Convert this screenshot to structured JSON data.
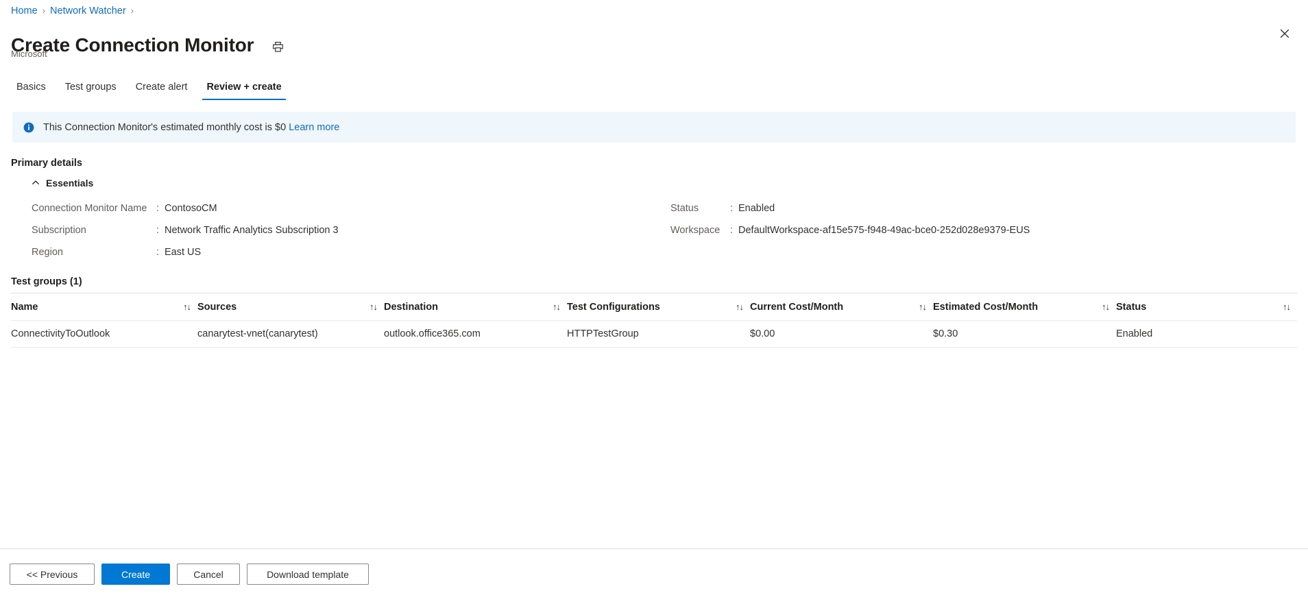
{
  "breadcrumb": {
    "items": [
      {
        "label": "Home"
      },
      {
        "label": "Network Watcher"
      }
    ],
    "separator": "›"
  },
  "header": {
    "title": "Create Connection Monitor",
    "subtitle": "Microsoft",
    "print_icon": "print-icon",
    "close_icon": "close-icon"
  },
  "tabs": [
    {
      "label": "Basics",
      "active": false
    },
    {
      "label": "Test groups",
      "active": false
    },
    {
      "label": "Create alert",
      "active": false
    },
    {
      "label": "Review + create",
      "active": true
    }
  ],
  "banner": {
    "icon": "info-icon",
    "text": "This Connection Monitor's estimated monthly cost is $0 ",
    "link_label": "Learn more",
    "background": "#eff6fc",
    "accent": "#0f6cbd"
  },
  "primary_details": {
    "heading": "Primary details",
    "essentials": {
      "label": "Essentials",
      "expanded": true,
      "chevron_icon": "chevron-up-icon",
      "left_column": [
        {
          "key": "Connection Monitor Name",
          "colon": ":",
          "value": "ContosoCM"
        },
        {
          "key": "Subscription",
          "colon": ":",
          "value": "Network Traffic Analytics Subscription 3"
        },
        {
          "key": "Region",
          "colon": ":",
          "value": "East US"
        }
      ],
      "right_column": [
        {
          "key": "Status",
          "colon": ":",
          "value": "Enabled"
        },
        {
          "key": "Workspace",
          "colon": ":",
          "value": "DefaultWorkspace-af15e575-f948-49ac-bce0-252d028e9379-EUS"
        }
      ]
    }
  },
  "test_groups": {
    "heading": "Test groups (1)",
    "sort_glyph": "↑↓",
    "columns": [
      {
        "label": "Name",
        "sortable": true
      },
      {
        "label": "Sources",
        "sortable": true
      },
      {
        "label": "Destination",
        "sortable": true
      },
      {
        "label": "Test Configurations",
        "sortable": true
      },
      {
        "label": "Current Cost/Month",
        "sortable": true
      },
      {
        "label": "Estimated Cost/Month",
        "sortable": true
      },
      {
        "label": "Status",
        "sortable": true
      }
    ],
    "rows": [
      {
        "name": "ConnectivityToOutlook",
        "sources": "canarytest-vnet(canarytest)",
        "destination": "outlook.office365.com",
        "test_configurations": "HTTPTestGroup",
        "current_cost_month": "$0.00",
        "estimated_cost_month": "$0.30",
        "status": "Enabled"
      }
    ]
  },
  "footer": {
    "buttons": [
      {
        "label": "<< Previous",
        "style": "secondary",
        "name": "previous-button"
      },
      {
        "label": "Create",
        "style": "primary",
        "name": "create-button"
      },
      {
        "label": "Cancel",
        "style": "secondary",
        "name": "cancel-button"
      },
      {
        "label": "Download template",
        "style": "secondary",
        "name": "download-template-button"
      }
    ]
  },
  "colors": {
    "link": "#0f6cbd",
    "primary_button": "#0078d4",
    "banner_bg": "#eff6fc",
    "divider": "#e1dfdd",
    "text": "#323130",
    "muted_text": "#605e5c"
  }
}
